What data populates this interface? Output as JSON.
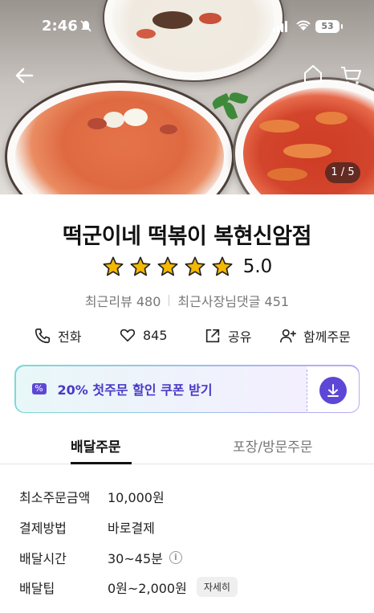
{
  "status_bar": {
    "time": "2:46",
    "battery": "53"
  },
  "hero": {
    "image_counter": "1 / 5"
  },
  "store": {
    "name": "떡군이네 떡볶이 복현신암점",
    "rating": "5.0",
    "stars": 5,
    "recent_reviews": "최근리뷰 480",
    "owner_replies": "최근사장님댓글 451"
  },
  "actions": {
    "call": "전화",
    "likes": "845",
    "share": "공유",
    "group_order": "함께주문"
  },
  "coupon": {
    "label": "20% 첫주문 할인 쿠폰 받기"
  },
  "tabs": {
    "delivery": "배달주문",
    "pickup": "포장/방문주문"
  },
  "delivery_info": {
    "min_order_label": "최소주문금액",
    "min_order_value": "10,000원",
    "payment_label": "결제방법",
    "payment_value": "바로결제",
    "time_label": "배달시간",
    "time_value": "30~45분",
    "tip_label": "배달팁",
    "tip_value": "0원~2,000원",
    "detail_button": "자세히"
  },
  "colors": {
    "accent": "#5d47d6",
    "star": "#f5b800"
  }
}
